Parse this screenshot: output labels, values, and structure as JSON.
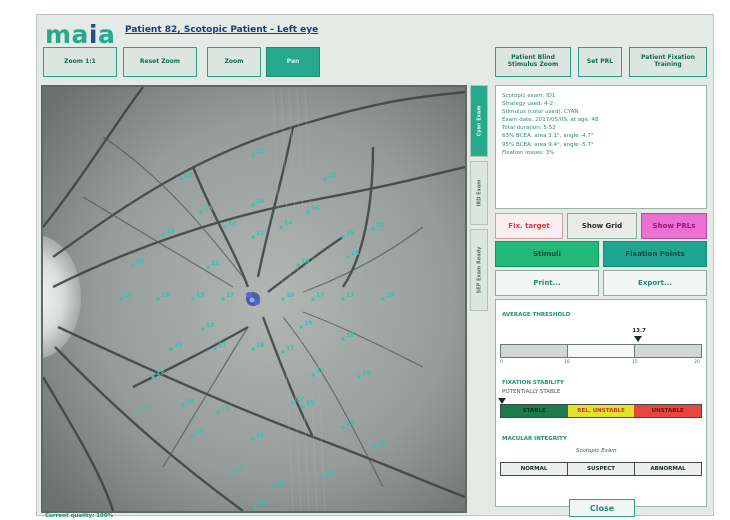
{
  "app": {
    "logo_left": "ma",
    "logo_mid": "i",
    "logo_right": "a",
    "title": "Patient 82, Scotopic Patient - Left eye"
  },
  "toolbar": {
    "zoom_1_1": "Zoom 1:1",
    "reset_zoom": "Reset Zoom",
    "zoom": "Zoom",
    "pan": "Pan",
    "patient_blind_stimulus_zoom": "Patient Blind Stimulus Zoom",
    "set_prl": "Set PRL",
    "patient_fixation_training": "Patient Fixation Training"
  },
  "side_tabs": {
    "tab1": "Cyan Exam",
    "tab2": "IRD Exam",
    "tab3": "SEP Exam Ready"
  },
  "info": {
    "lines": [
      "Scotopic exam: ID1",
      "Strategy used: 4-2",
      "Stimulus (color used): CYAN",
      "Exam date: 2017/05/09, at age: 48",
      "Total duration: 5:52",
      "63% BCEA: area 3.1°, angle -4.7°",
      "95% BCEA: area 9.4°, angle -5.7°",
      "Fixation losses: 3%"
    ]
  },
  "buttons": {
    "fix_target": "Fix. target",
    "show_grid": "Show Grid",
    "show_prls": "Show PRLs",
    "stimuli": "Stimuli",
    "fixation_points": "Fixation Points",
    "print": "Print...",
    "export": "Export..."
  },
  "threshold": {
    "title": "AVERAGE THRESHOLD",
    "value": "13.7",
    "value_num": 13.7,
    "scale_min": 0,
    "scale_max": 20,
    "ticks": [
      "0",
      "10",
      "15",
      "20"
    ]
  },
  "fixation_stability": {
    "title": "FIXATION STABILITY",
    "subtitle": "POTENTIALLY STABLE",
    "options": [
      "STABLE",
      "REL. UNSTABLE",
      "UNSTABLE"
    ]
  },
  "macular_integrity": {
    "title": "MACULAR INTEGRITY",
    "subtitle": "Scotopic Exam",
    "options": [
      "NORMAL",
      "SUSPECT",
      "ABNORMAL"
    ]
  },
  "close_label": "Close",
  "status": "Current quality: 100%",
  "colors": {
    "accent": "#27a98c",
    "title_blue": "#1b3d7d",
    "stimulus_cyan": "#33c4b2"
  },
  "stimuli": [
    {
      "label": "19"
    },
    {
      "label": "19"
    },
    {
      "label": "19"
    },
    {
      "label": "16"
    },
    {
      "label": "16"
    },
    {
      "label": "20"
    },
    {
      "label": "12"
    },
    {
      "label": "10"
    },
    {
      "label": "14"
    },
    {
      "label": "15"
    },
    {
      "label": "19"
    },
    {
      "label": "20"
    },
    {
      "label": "15"
    },
    {
      "label": "12"
    },
    {
      "label": "16"
    },
    {
      "label": "15"
    },
    {
      "label": "19"
    },
    {
      "label": "19"
    },
    {
      "label": "19"
    },
    {
      "label": "17"
    },
    {
      "label": "10"
    },
    {
      "label": "17"
    },
    {
      "label": "17"
    },
    {
      "label": "15"
    },
    {
      "label": "18"
    },
    {
      "label": "19"
    },
    {
      "label": "16"
    },
    {
      "label": "15"
    },
    {
      "label": "17"
    },
    {
      "label": "18"
    },
    {
      "label": "17"
    },
    {
      "label": "17"
    },
    {
      "label": "17"
    },
    {
      "label": "18"
    },
    {
      "label": "19"
    },
    {
      "label": "19"
    },
    {
      "label": "15"
    },
    {
      "label": "17"
    },
    {
      "label": "15"
    },
    {
      "label": "16"
    },
    {
      "label": "15"
    },
    {
      "label": "15"
    },
    {
      "label": "15"
    },
    {
      "label": "15"
    },
    {
      "label": "15"
    },
    {
      "label": "16"
    },
    {
      "label": "16"
    }
  ]
}
